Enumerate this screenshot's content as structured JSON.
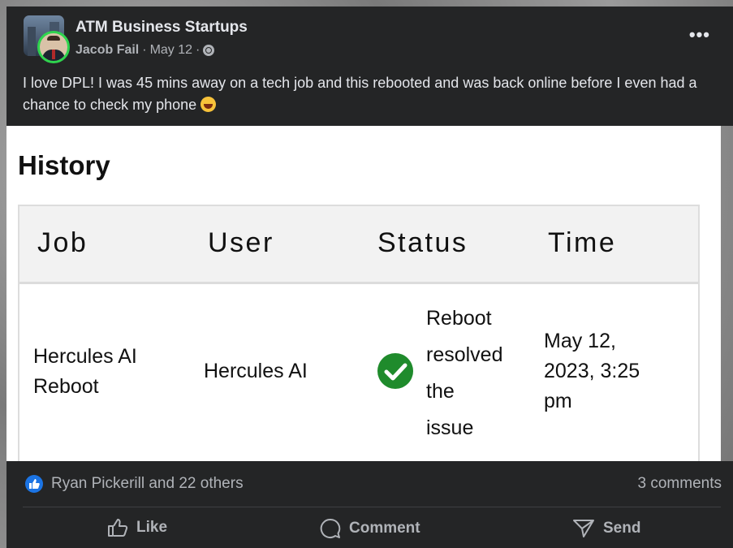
{
  "post": {
    "group_name": "ATM Business Startups",
    "author": "Jacob Fail",
    "date": "May 12",
    "separator": "·",
    "visibility_icon": "globe-icon",
    "more_icon": "more-options-icon",
    "more_label": "•••",
    "text": "I love DPL! I was 45 mins away on a tech job and this rebooted and was back online before I even had a chance to check my phone",
    "emoji": "laughing-emoji"
  },
  "history": {
    "title": "History",
    "columns": [
      "Job",
      "User",
      "Status",
      "Time"
    ],
    "rows": [
      {
        "job_line1": "Hercules AI",
        "job_line2": "Reboot",
        "user": "Hercules AI",
        "status_icon": "check-circle-icon",
        "status_color": "#1f8b2c",
        "status_line1": "Reboot",
        "status_line2": "resolved",
        "status_line3": "the",
        "status_line4": "issue",
        "time_line1": "May 12,",
        "time_line2": "2023, 3:25",
        "time_line3": "pm"
      }
    ]
  },
  "footer": {
    "reactions": "Ryan Pickerill and 22 others",
    "comments": "3 comments",
    "actions": {
      "like": "Like",
      "comment": "Comment",
      "send": "Send"
    },
    "accent": "#1b74e4"
  }
}
